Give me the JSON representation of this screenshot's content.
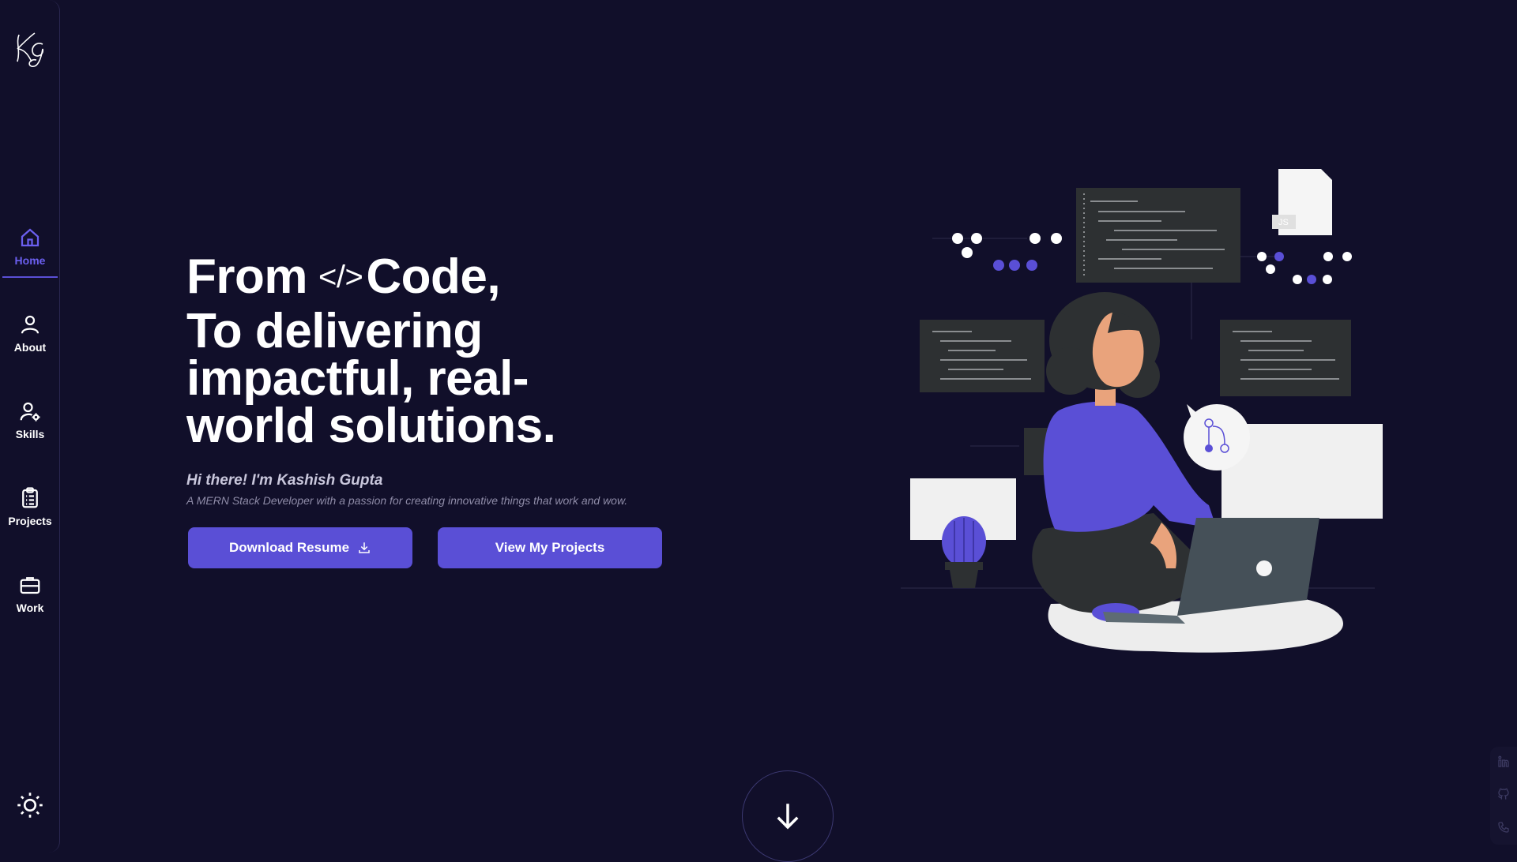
{
  "sidebar": {
    "logo_text": "KG",
    "items": [
      {
        "label": "Home",
        "active": true
      },
      {
        "label": "About",
        "active": false
      },
      {
        "label": "Skills",
        "active": false
      },
      {
        "label": "Projects",
        "active": false
      },
      {
        "label": "Work",
        "active": false
      }
    ]
  },
  "hero": {
    "line1_word1": "From",
    "code_symbol": "</>",
    "line1_word2": "Code,",
    "line2": "To delivering",
    "line3": "impactful, real-",
    "line4": "world solutions.",
    "greeting": "Hi there! I'm Kashish Gupta",
    "tagline": "A MERN Stack Developer with a passion for creating innovative things that work and wow."
  },
  "buttons": {
    "download_resume": "Download Resume",
    "view_projects": "View My Projects"
  },
  "illustration": {
    "file_badge": "JS"
  },
  "colors": {
    "background": "#110f2a",
    "accent": "#5a4fd6",
    "active_nav": "#6b5ff0"
  }
}
